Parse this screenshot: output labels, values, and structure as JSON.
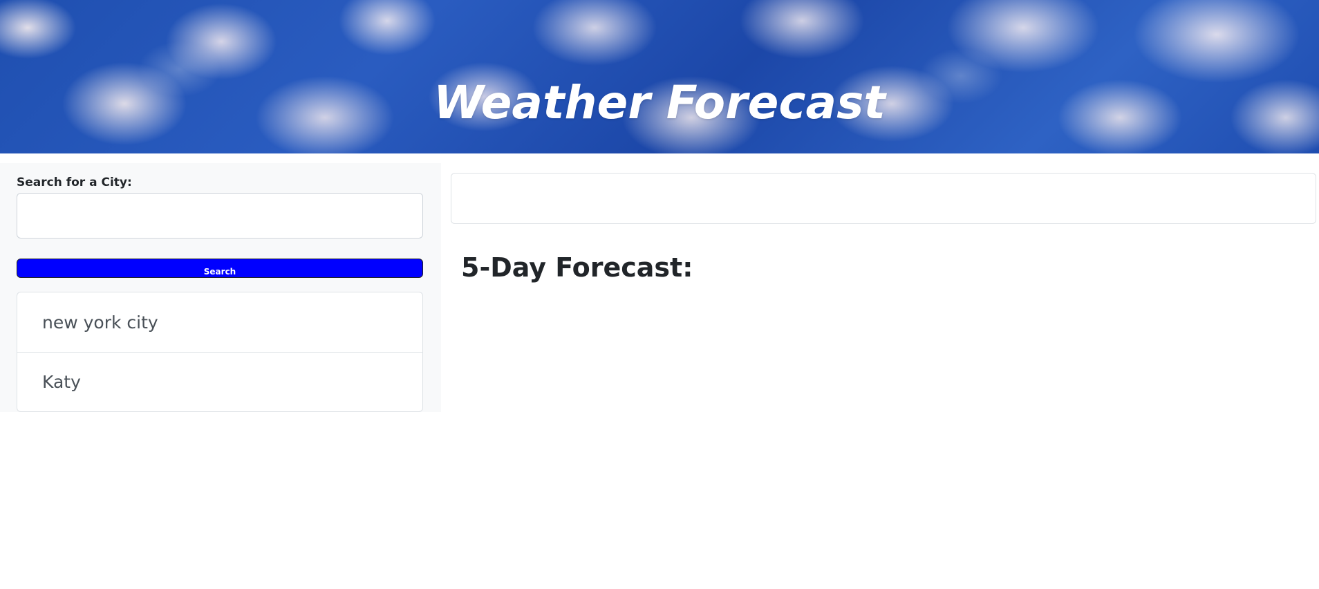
{
  "header": {
    "title": "Weather Forecast"
  },
  "search": {
    "label": "Search for a City:",
    "value": "",
    "placeholder": "",
    "button_label": "Search"
  },
  "history": {
    "items": [
      {
        "label": "new york city"
      },
      {
        "label": "Katy"
      }
    ]
  },
  "main": {
    "forecast_heading": "5-Day Forecast:"
  },
  "colors": {
    "search_button": "#0000ff",
    "sidebar_bg": "#f8f9fa"
  }
}
